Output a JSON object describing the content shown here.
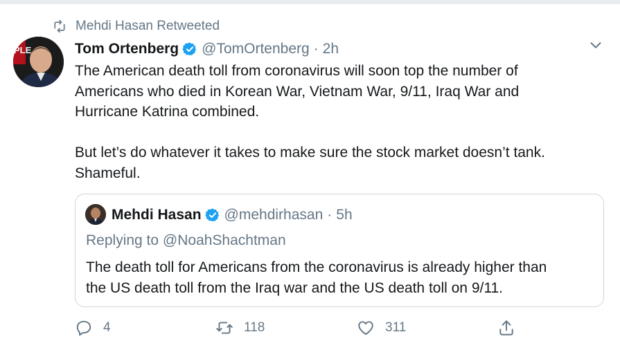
{
  "retweet_context": {
    "icon": "retweet-icon",
    "text": "Mehdi Hasan Retweeted"
  },
  "tweet": {
    "author": {
      "name": "Tom Ortenberg",
      "handle": "@TomOrtenberg",
      "verified": true
    },
    "separator": "·",
    "time": "2h",
    "text_lines": [
      "The American death toll from coronavirus will soon top the number of",
      "Americans who died in Korean War, Vietnam War, 9/11, Iraq War and",
      "Hurricane Katrina combined.",
      "",
      "But let’s do whatever it takes to make sure the stock market doesn’t tank.",
      "Shameful."
    ]
  },
  "quoted_tweet": {
    "author": {
      "name": "Mehdi Hasan",
      "handle": "@mehdirhasan",
      "verified": true
    },
    "separator": "·",
    "time": "5h",
    "replying_to_prefix": "Replying to",
    "replying_to_handle": "@NoahShachtman",
    "text_lines": [
      "The death toll for Americans from the coronavirus is already higher than",
      "the US death toll from the Iraq war and the US death toll on 9/11."
    ]
  },
  "actions": {
    "reply_count": "4",
    "retweet_count": "118",
    "like_count": "311"
  },
  "colors": {
    "text_primary": "#14171a",
    "text_secondary": "#657786",
    "verified_blue": "#1da1f2",
    "border": "#ccd6dd"
  }
}
